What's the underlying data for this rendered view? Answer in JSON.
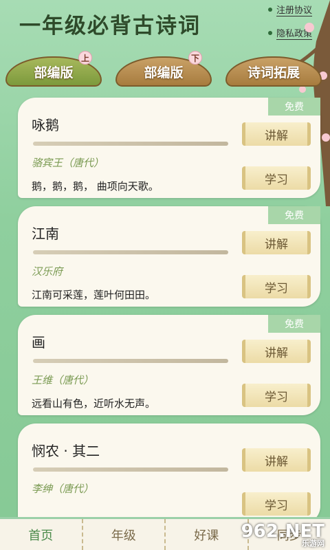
{
  "header": {
    "title": "一年级必背古诗词",
    "links": [
      "注册协议",
      "隐私政策"
    ]
  },
  "tabs": [
    {
      "label": "部编版",
      "badge": "上",
      "active": true
    },
    {
      "label": "部编版",
      "badge": "下",
      "active": false
    },
    {
      "label": "诗词拓展",
      "badge": "",
      "active": false
    }
  ],
  "poems": [
    {
      "title": "咏鹅",
      "author": "骆宾王（唐代）",
      "verse": "鹅，鹅，鹅， 曲项向天歌。",
      "badge": "免费",
      "explain": "讲解",
      "study": "学习"
    },
    {
      "title": "江南",
      "author": "汉乐府",
      "verse": "江南可采莲，莲叶何田田。",
      "badge": "免费",
      "explain": "讲解",
      "study": "学习"
    },
    {
      "title": "画",
      "author": "王维（唐代）",
      "verse": "远看山有色，近听水无声。",
      "badge": "免费",
      "explain": "讲解",
      "study": "学习"
    },
    {
      "title": "悯农 · 其二",
      "author": "李绅（唐代）",
      "verse": "",
      "badge": "",
      "explain": "讲解",
      "study": "学习"
    }
  ],
  "nav": [
    {
      "label": "首页",
      "active": true
    },
    {
      "label": "年级",
      "active": false
    },
    {
      "label": "好课",
      "active": false
    },
    {
      "label": "同步",
      "active": false
    }
  ],
  "watermark": {
    "main": "962.NET",
    "sub": "乐游网"
  }
}
